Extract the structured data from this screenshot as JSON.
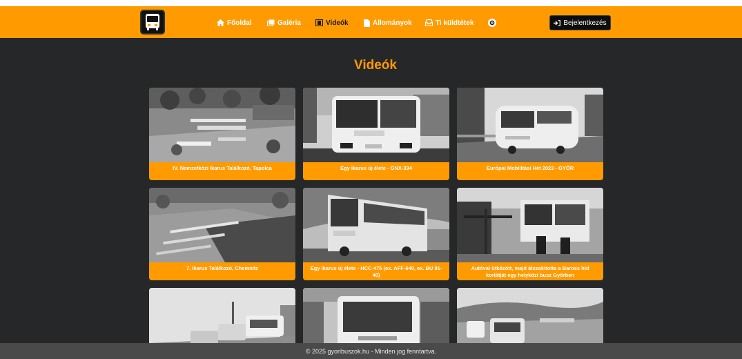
{
  "nav": {
    "items": [
      {
        "label": "Főoldal",
        "icon": "home-icon"
      },
      {
        "label": "Galéria",
        "icon": "images-icon"
      },
      {
        "label": "Videók",
        "icon": "film-icon"
      },
      {
        "label": "Állományok",
        "icon": "document-icon"
      },
      {
        "label": "Ti küldtétek",
        "icon": "inbox-icon"
      }
    ],
    "theme_icon": "gear-icon",
    "login_label": "Bejelentkezés",
    "login_icon": "sign-in-icon"
  },
  "page": {
    "title": "Videók"
  },
  "videos": [
    {
      "title": "IV. Nemzetközi Ikarus Találkozó, Tapolca"
    },
    {
      "title": "Egy Ikarus új élete - GNX-334"
    },
    {
      "title": "Európai Mobilitási Hét 2023 - GYŐR"
    },
    {
      "title": "7. Ikarus Találkozó, Chemnitz"
    },
    {
      "title": "Egy Ikarus új élete - HCC-475 (ex. AFF-640, ex. BU 91-40)"
    },
    {
      "title": "Autóval ütközött, majd átszakította a Baross híd korlátját egy helyközi busz Győrben"
    },
    {
      "title": ""
    },
    {
      "title": ""
    },
    {
      "title": ""
    }
  ],
  "footer": {
    "text": "© 2025 gyoribuszok.hu - Minden jog fenntartva."
  },
  "colors": {
    "accent": "#ff9b00",
    "background": "#262728",
    "footer": "#4a4a4a"
  }
}
